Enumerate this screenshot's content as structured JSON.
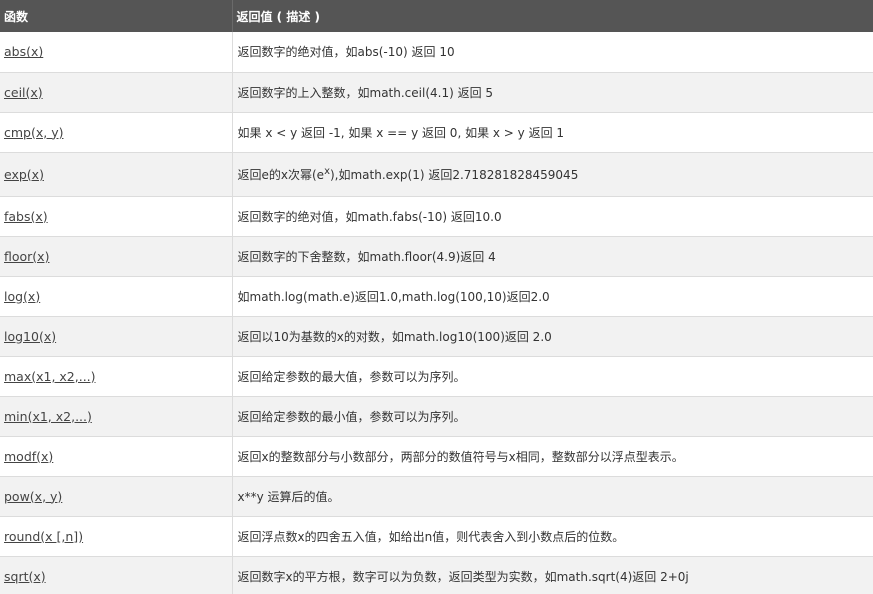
{
  "header": {
    "col_function": "函数",
    "col_return": "返回值 ( 描述 )"
  },
  "rows": [
    {
      "fn": "abs(x)",
      "desc": "返回数字的绝对值，如abs(-10) 返回 10"
    },
    {
      "fn": "ceil(x)",
      "desc": "返回数字的上入整数，如math.ceil(4.1) 返回 5"
    },
    {
      "fn": "cmp(x, y)",
      "desc": "如果 x < y 返回 -1, 如果 x == y 返回 0, 如果 x > y 返回 1"
    },
    {
      "fn": "exp(x)",
      "desc_pre": "返回e的x次幂(e",
      "desc_sup": "x",
      "desc_post": "),如math.exp(1) 返回2.718281828459045"
    },
    {
      "fn": "fabs(x)",
      "desc": "返回数字的绝对值，如math.fabs(-10) 返回10.0"
    },
    {
      "fn": "floor(x)",
      "desc": "返回数字的下舍整数，如math.floor(4.9)返回 4"
    },
    {
      "fn": "log(x)",
      "desc": "如math.log(math.e)返回1.0,math.log(100,10)返回2.0"
    },
    {
      "fn": "log10(x)",
      "desc": "返回以10为基数的x的对数，如math.log10(100)返回 2.0"
    },
    {
      "fn": "max(x1, x2,...)",
      "desc": "返回给定参数的最大值，参数可以为序列。"
    },
    {
      "fn": "min(x1, x2,...)",
      "desc": "返回给定参数的最小值，参数可以为序列。"
    },
    {
      "fn": "modf(x)",
      "desc": "返回x的整数部分与小数部分，两部分的数值符号与x相同，整数部分以浮点型表示。"
    },
    {
      "fn": "pow(x, y)",
      "desc": "x**y 运算后的值。"
    },
    {
      "fn": "round(x [,n])",
      "desc": "返回浮点数x的四舍五入值，如给出n值，则代表舍入到小数点后的位数。"
    },
    {
      "fn": "sqrt(x)",
      "desc": "返回数字x的平方根，数字可以为负数，返回类型为实数，如math.sqrt(4)返回 2+0j"
    }
  ]
}
